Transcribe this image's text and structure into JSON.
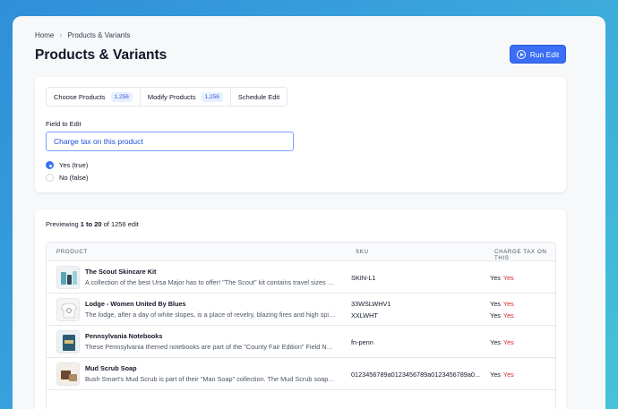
{
  "breadcrumb": {
    "home": "Home",
    "current": "Products & Variants"
  },
  "page": {
    "title": "Products & Variants",
    "run_label": "Run Edit"
  },
  "tabs": [
    {
      "label": "Choose Products",
      "badge": "1,256"
    },
    {
      "label": "Modify Products",
      "badge": "1,256"
    },
    {
      "label": "Schedule Edit",
      "badge": ""
    }
  ],
  "field": {
    "label": "Field to Edit",
    "value": "Charge tax on this product"
  },
  "options": [
    {
      "label": "Yes (true)",
      "selected": true
    },
    {
      "label": "No (false)",
      "selected": false
    }
  ],
  "preview": {
    "prefix": "Previewing ",
    "range": "1 to 20",
    "suffix": " of 1256 edit"
  },
  "table": {
    "headers": {
      "product": "PRODUCT",
      "sku": "SKU",
      "tax": "CHARGE TAX ON THIS"
    },
    "rows": [
      {
        "name": "The Scout Skincare Kit",
        "desc": "A collection of the best Ursa Major has to offer! \"The Scout\" kit contains travel sizes of...",
        "skus": [
          {
            "sku": "SKIN-L1",
            "old": "Yes",
            "new": "Yes"
          }
        ]
      },
      {
        "name": "Lodge - Women United By Blues",
        "desc": "The lodge, after a day of white slopes, is a place of revelry, blazing fires and high spirit...",
        "skus": [
          {
            "sku": "33WSLWHV1",
            "old": "Yes",
            "new": "Yes"
          },
          {
            "sku": "XXLWHT",
            "old": "Yes",
            "new": "Yes"
          }
        ]
      },
      {
        "name": "Pennsylvania Notebooks",
        "desc": "These Pennsylvania themed notebooks are part of the \"County Fair Edition\" Field Note...",
        "skus": [
          {
            "sku": "fn-penn",
            "old": "Yes",
            "new": "Yes"
          }
        ]
      },
      {
        "name": "Mud Scrub Soap",
        "desc": "Bush Smart's Mud Scrub is part of their \"Man Soap\" collection. The Mud Scrub soap is...",
        "skus": [
          {
            "sku": "0123456789a0123456789a0123456789a0...",
            "old": "Yes",
            "new": "Yes"
          }
        ]
      }
    ]
  },
  "colors": {
    "accent": "#3b6ef5",
    "changed": "#dc2626"
  }
}
